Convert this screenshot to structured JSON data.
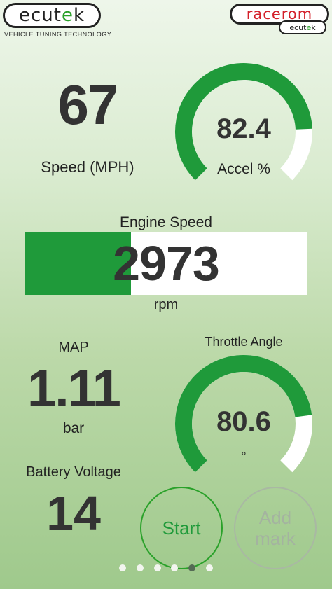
{
  "logos": {
    "left_brand_prefix": "ecut",
    "left_brand_accent": "e",
    "left_brand_suffix": "k",
    "left_tagline": "VEHICLE TUNING TECHNOLOGY",
    "right_brand": "racerom",
    "right_sub_prefix": "ecut",
    "right_sub_accent": "e",
    "right_sub_suffix": "k"
  },
  "speed": {
    "value": "67",
    "label": "Speed (MPH)"
  },
  "accel": {
    "value": "82.4",
    "label": "Accel %",
    "fraction": 0.824
  },
  "engine_speed": {
    "title": "Engine Speed",
    "value": "2973",
    "unit": "rpm",
    "fill_fraction": 0.375
  },
  "map": {
    "title": "MAP",
    "value": "1.11",
    "unit": "bar"
  },
  "throttle": {
    "title": "Throttle Angle",
    "value": "80.6",
    "unit": "°",
    "fraction": 0.806
  },
  "battery": {
    "title": "Battery Voltage",
    "value": "14"
  },
  "buttons": {
    "start": "Start",
    "add_mark": "Add\nmark"
  },
  "pager": {
    "count": 6,
    "active_index": 4
  },
  "colors": {
    "accent_green": "#1f9a3a",
    "gauge_track": "#ffffff",
    "start_text": "#1f9a3a",
    "disabled": "#a4b3a0"
  }
}
